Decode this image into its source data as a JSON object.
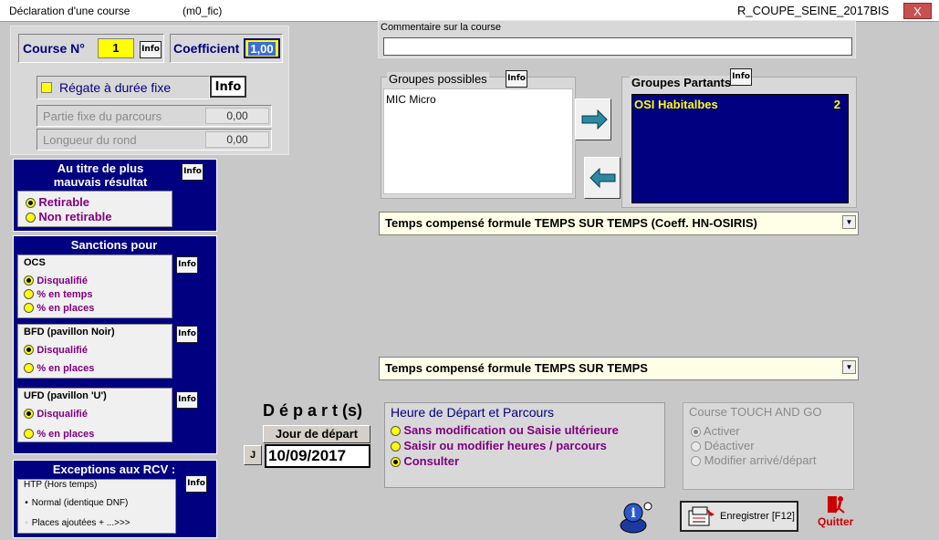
{
  "window": {
    "title": "Déclaration d'une course",
    "form_code": "(m0_fic)",
    "course_name": "R_COUPE_SEINE_2017BIS",
    "close_label": "X"
  },
  "course": {
    "number_label": "Course N°",
    "number_value": "1",
    "coefficient_label": "Coefficient",
    "coefficient_value": "1,00"
  },
  "regate": {
    "label": "Régate à durée fixe",
    "partie_fixe_label": "Partie fixe du parcours",
    "partie_fixe_value": "0,00",
    "longueur_label": "Longueur du rond",
    "longueur_value": "0,00"
  },
  "info_label": "Info",
  "mauvais": {
    "title_line1": "Au titre de plus",
    "title_line2": "mauvais résultat",
    "options": [
      "Retirable",
      "Non retirable"
    ]
  },
  "sanctions": {
    "title": "Sanctions pour",
    "ocs": {
      "label": "OCS",
      "options": [
        "Disqualifié",
        "% en  temps",
        "% en places"
      ]
    },
    "bfd": {
      "label": "BFD (pavillon Noir)",
      "options": [
        "Disqualifié",
        "% en places"
      ]
    },
    "ufd": {
      "label": "UFD (pavillon 'U')",
      "options": [
        "Disqualifié",
        "% en places"
      ]
    }
  },
  "exceptions": {
    "title": "Exceptions aux RCV :",
    "group_label": "HTP (Hors temps)",
    "options": [
      "Normal (identique DNF)",
      "Places ajoutées + ...>>>"
    ]
  },
  "comment": {
    "label": "Commentaire sur la course",
    "value": ""
  },
  "groupes_possibles": {
    "label": "Groupes possibles",
    "items": [
      "MIC Micro"
    ]
  },
  "groupes_partants": {
    "label": "Groupes Partants",
    "items": [
      {
        "name": "OSI Habitalbes",
        "count": "2"
      }
    ]
  },
  "formula1": "Temps compensé formule TEMPS SUR TEMPS (Coeff. HN-OSIRIS)",
  "formula2": "Temps compensé formule TEMPS SUR TEMPS",
  "depart": {
    "heading": "D é p a r t (s)",
    "jour_label": "Jour de départ",
    "j_button": "J",
    "date_value": "10/09/2017"
  },
  "heure": {
    "title": "Heure de Départ et Parcours",
    "options": [
      "Sans modification ou Saisie ultérieure",
      "Saisir ou modifier heures / parcours",
      "Consulter"
    ]
  },
  "touch": {
    "title": "Course TOUCH AND GO",
    "options": [
      "Activer",
      "Déactiver",
      "Modifier arrivé/départ"
    ]
  },
  "buttons": {
    "save": "Enregistrer [F12]",
    "quit": "Quitter"
  },
  "colors": {
    "navy": "#000080",
    "yellow": "#ffff00",
    "purple": "#800080",
    "quit_red": "#cc0000"
  }
}
